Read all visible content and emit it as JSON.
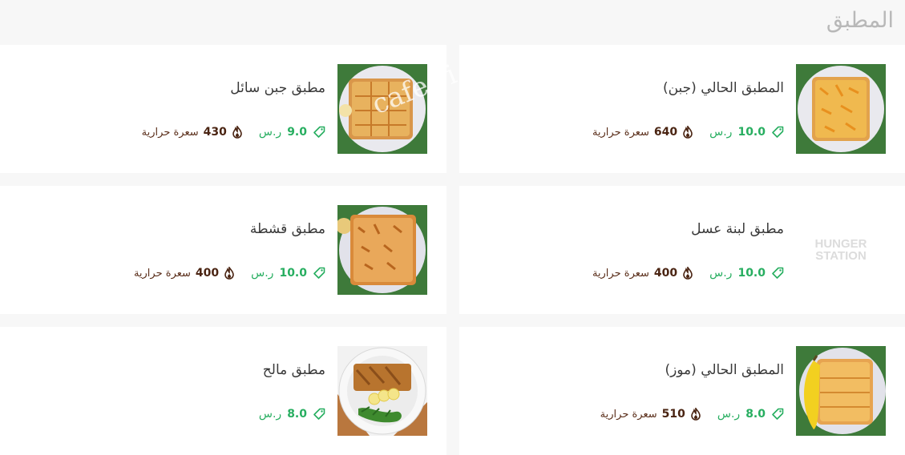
{
  "section": {
    "title": "المطبق"
  },
  "watermark": "cafe ri",
  "items": [
    {
      "name": "المطبق الحالي (جبن)",
      "price": "10.0",
      "currency": "ر.س",
      "calories": "640",
      "calories_label": "سعرة حرارية",
      "image": "cheese-mutabbaq-photo"
    },
    {
      "name": "مطبق جبن سائل",
      "price": "9.0",
      "currency": "ر.س",
      "calories": "430",
      "calories_label": "سعرة حرارية",
      "image": "liquid-cheese-mutabbaq-photo"
    },
    {
      "name": "مطبق لبنة عسل",
      "price": "10.0",
      "currency": "ر.س",
      "calories": "400",
      "calories_label": "سعرة حرارية",
      "image": "hungerstation-placeholder",
      "logo_text": [
        "HUNGER",
        "STATION"
      ]
    },
    {
      "name": "مطبق قشطة",
      "price": "10.0",
      "currency": "ر.س",
      "calories": "400",
      "calories_label": "سعرة حرارية",
      "image": "cream-mutabbaq-photo"
    },
    {
      "name": "المطبق الحالي (موز)",
      "price": "8.0",
      "currency": "ر.س",
      "calories": "510",
      "calories_label": "سعرة حرارية",
      "image": "banana-mutabbaq-photo"
    },
    {
      "name": "مطبق مالح",
      "price": "8.0",
      "currency": "ر.س",
      "image": "savory-mutabbaq-photo"
    }
  ],
  "colors": {
    "price": "#27ae60",
    "calories": "#4a2412",
    "title": "#b8b8b8",
    "plate_green": "#3e7a3a"
  }
}
